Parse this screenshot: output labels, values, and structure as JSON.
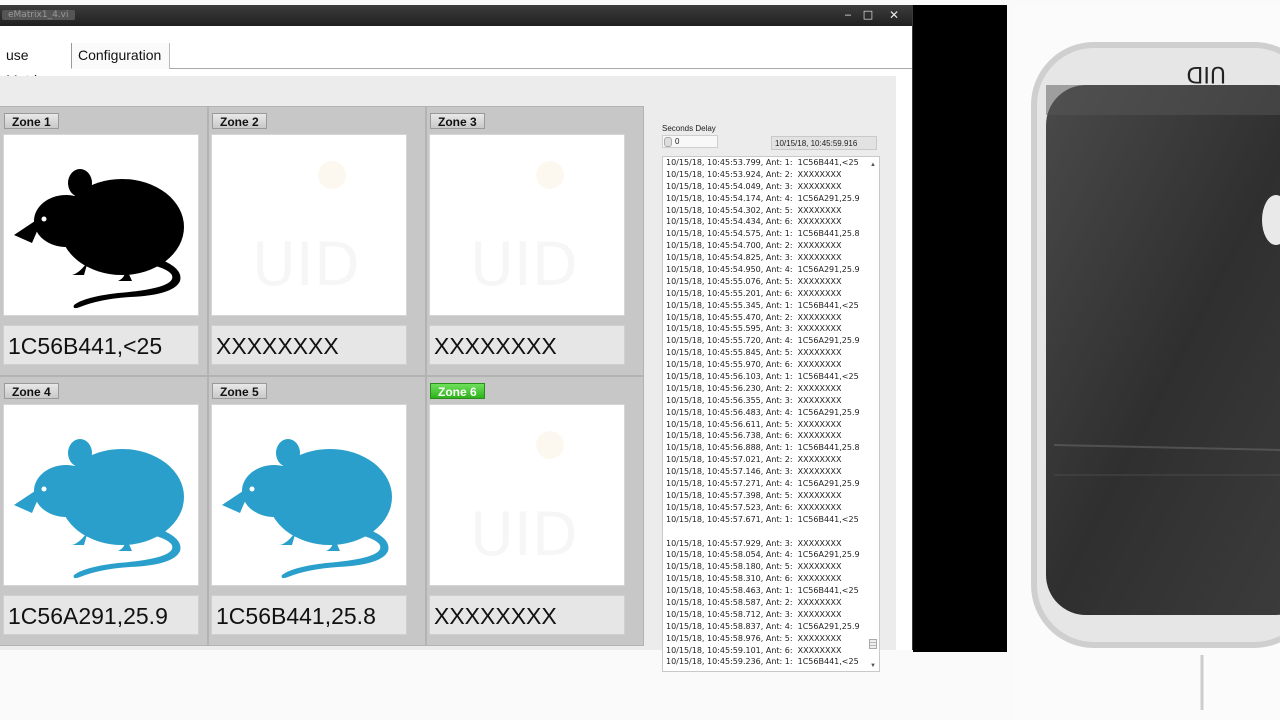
{
  "window": {
    "title": "eMatrix1_4.vi",
    "controls": {
      "minimize": "‒",
      "maximize": "□",
      "close": "✕"
    }
  },
  "tabs": [
    {
      "label": "use Matrix",
      "active": true
    },
    {
      "label": "Configuration",
      "active": false
    }
  ],
  "zones": [
    {
      "label": "Zone 1",
      "value": "1C56B441,<25",
      "mouse": "black",
      "active": false
    },
    {
      "label": "Zone 2",
      "value": "XXXXXXXX",
      "mouse": "none",
      "active": false
    },
    {
      "label": "Zone 3",
      "value": "XXXXXXXX",
      "mouse": "none",
      "active": false
    },
    {
      "label": "Zone 4",
      "value": "1C56A291,25.9",
      "mouse": "blue",
      "active": false
    },
    {
      "label": "Zone 5",
      "value": "1C56B441,25.8",
      "mouse": "blue",
      "active": false
    },
    {
      "label": "Zone 6",
      "value": "XXXXXXXX",
      "mouse": "none",
      "active": true
    }
  ],
  "colors": {
    "mouse_black": "#000000",
    "mouse_blue": "#2b9fcb",
    "zone_active": "#35b722"
  },
  "delay": {
    "label": "Seconds Delay",
    "value": "0"
  },
  "clock": "10/15/18, 10:45:59.916",
  "log": [
    "10/15/18, 10:45:53.799, Ant: 1:  1C56B441,<25",
    "10/15/18, 10:45:53.924, Ant: 2:  XXXXXXXX",
    "10/15/18, 10:45:54.049, Ant: 3:  XXXXXXXX",
    "10/15/18, 10:45:54.174, Ant: 4:  1C56A291,25.9",
    "10/15/18, 10:45:54.302, Ant: 5:  XXXXXXXX",
    "10/15/18, 10:45:54.434, Ant: 6:  XXXXXXXX",
    "10/15/18, 10:45:54.575, Ant: 1:  1C56B441,25.8",
    "10/15/18, 10:45:54.700, Ant: 2:  XXXXXXXX",
    "10/15/18, 10:45:54.825, Ant: 3:  XXXXXXXX",
    "10/15/18, 10:45:54.950, Ant: 4:  1C56A291,25.9",
    "10/15/18, 10:45:55.076, Ant: 5:  XXXXXXXX",
    "10/15/18, 10:45:55.201, Ant: 6:  XXXXXXXX",
    "10/15/18, 10:45:55.345, Ant: 1:  1C56B441,<25",
    "10/15/18, 10:45:55.470, Ant: 2:  XXXXXXXX",
    "10/15/18, 10:45:55.595, Ant: 3:  XXXXXXXX",
    "10/15/18, 10:45:55.720, Ant: 4:  1C56A291,25.9",
    "10/15/18, 10:45:55.845, Ant: 5:  XXXXXXXX",
    "10/15/18, 10:45:55.970, Ant: 6:  XXXXXXXX",
    "10/15/18, 10:45:56.103, Ant: 1:  1C56B441,<25",
    "10/15/18, 10:45:56.230, Ant: 2:  XXXXXXXX",
    "10/15/18, 10:45:56.355, Ant: 3:  XXXXXXXX",
    "10/15/18, 10:45:56.483, Ant: 4:  1C56A291,25.9",
    "10/15/18, 10:45:56.611, Ant: 5:  XXXXXXXX",
    "10/15/18, 10:45:56.738, Ant: 6:  XXXXXXXX",
    "10/15/18, 10:45:56.888, Ant: 1:  1C56B441,25.8",
    "10/15/18, 10:45:57.021, Ant: 2:  XXXXXXXX",
    "10/15/18, 10:45:57.146, Ant: 3:  XXXXXXXX",
    "10/15/18, 10:45:57.271, Ant: 4:  1C56A291,25.9",
    "10/15/18, 10:45:57.398, Ant: 5:  XXXXXXXX",
    "10/15/18, 10:45:57.523, Ant: 6:  XXXXXXXX",
    "10/15/18, 10:45:57.671, Ant: 1:  1C56B441,<25",
    "",
    "10/15/18, 10:45:57.929, Ant: 3:  XXXXXXXX",
    "10/15/18, 10:45:58.054, Ant: 4:  1C56A291,25.9",
    "10/15/18, 10:45:58.180, Ant: 5:  XXXXXXXX",
    "10/15/18, 10:45:58.310, Ant: 6:  XXXXXXXX",
    "10/15/18, 10:45:58.463, Ant: 1:  1C56B441,<25",
    "10/15/18, 10:45:58.587, Ant: 2:  XXXXXXXX",
    "10/15/18, 10:45:58.712, Ant: 3:  XXXXXXXX",
    "10/15/18, 10:45:58.837, Ant: 4:  1C56A291,25.9",
    "10/15/18, 10:45:58.976, Ant: 5:  XXXXXXXX",
    "10/15/18, 10:45:59.101, Ant: 6:  XXXXXXXX",
    "10/15/18, 10:45:59.236, Ant: 1:  1C56B441,<25"
  ]
}
